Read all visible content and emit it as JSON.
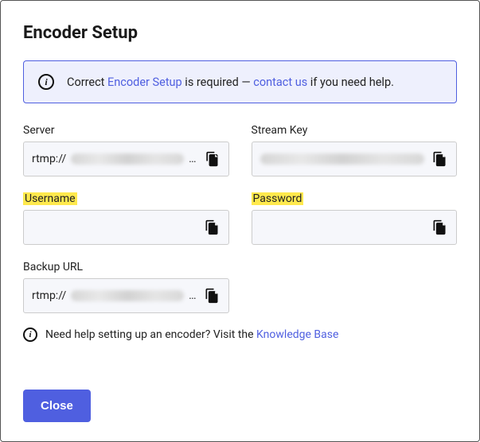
{
  "title": "Encoder Setup",
  "banner": {
    "pre": "Correct ",
    "link1": "Encoder Setup",
    "mid": " is required — ",
    "link2": "contact us",
    "post": " if you need help."
  },
  "fields": {
    "server": {
      "label": "Server",
      "prefix": "rtmp://"
    },
    "stream_key": {
      "label": "Stream Key"
    },
    "username": {
      "label": "Username"
    },
    "password": {
      "label": "Password"
    },
    "backup_url": {
      "label": "Backup URL",
      "prefix": "rtmp://"
    }
  },
  "help": {
    "text": "Need help setting up an encoder? Visit the ",
    "link": "Knowledge Base"
  },
  "buttons": {
    "close": "Close"
  },
  "icons": {
    "info_glyph": "i"
  }
}
